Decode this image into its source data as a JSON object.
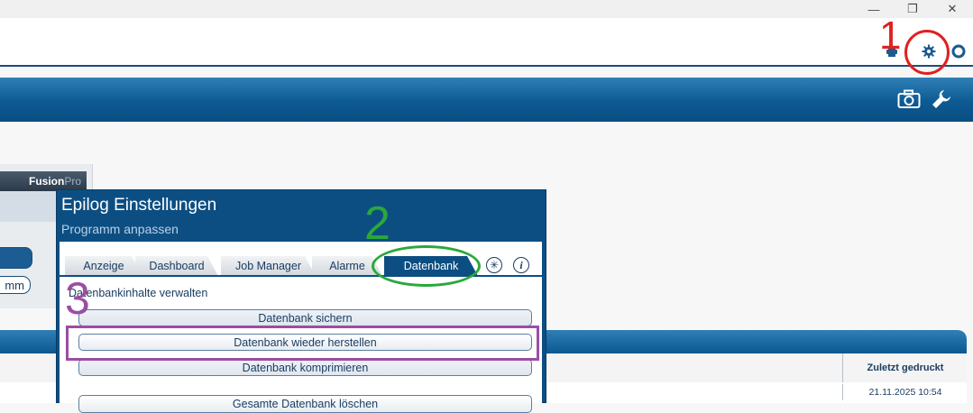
{
  "window": {
    "controls": [
      "—",
      "❐",
      "✕"
    ]
  },
  "header": {
    "icons": [
      "printer-icon",
      "gear-icon",
      "support-icon"
    ]
  },
  "toolbar": {
    "icons": [
      "camera-icon",
      "wrench-icon"
    ]
  },
  "background_app": {
    "brand_main": "Fusion",
    "brand_sub": "Pro",
    "button2_text": "mm",
    "table": {
      "column_header": "Zuletzt gedruckt",
      "row_value": "21.11.2025 10:54"
    }
  },
  "dialog": {
    "title": "Epilog Einstellungen",
    "subtitle": "Programm anpassen",
    "tabs": [
      {
        "label": "Anzeige",
        "active": false
      },
      {
        "label": "Dashboard",
        "active": false
      },
      {
        "label": "Job Manager",
        "active": false
      },
      {
        "label": "Alarme",
        "active": false
      },
      {
        "label": "Datenbank",
        "active": true
      }
    ],
    "extra_icons": [
      "asterisk-icon",
      "info-icon"
    ],
    "section_title": "Datenbankinhalte verwalten",
    "buttons": [
      "Datenbank sichern",
      "Datenbank wieder herstellen",
      "Datenbank komprimieren",
      "Gesamte Datenbank löschen"
    ]
  },
  "annotations": {
    "step1": "1",
    "step2": "2",
    "step3": "3",
    "colors": {
      "red": "#e02020",
      "green": "#2aa83a",
      "purple": "#9b4ea3"
    }
  }
}
